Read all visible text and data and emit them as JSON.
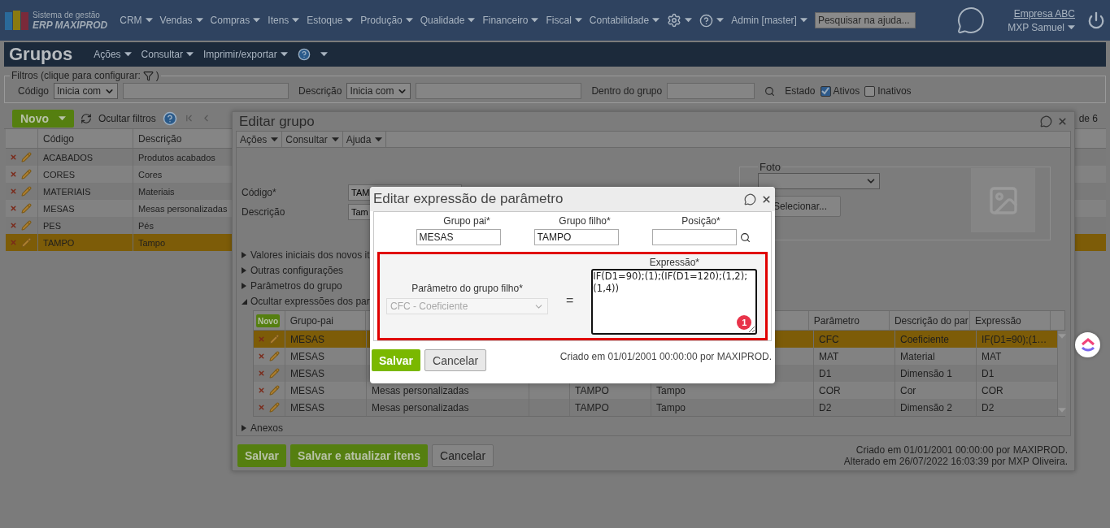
{
  "top_nav": {
    "logo_line_1": "Sistema de gestão",
    "logo_line_2": "ERP MAXIPROD",
    "menus": [
      "CRM",
      "Vendas",
      "Compras",
      "Itens",
      "Estoque",
      "Produção",
      "Qualidade",
      "Financeiro",
      "Fiscal",
      "Contabilidade"
    ],
    "user_menu": "Admin [master]",
    "help_search": {
      "placeholder": "Pesquisar na ajuda..."
    },
    "company_link": "Empresa ABC",
    "user_name": "MXP Samuel"
  },
  "page_header": {
    "title": "Grupos",
    "menus": [
      "Ações",
      "Consultar",
      "Imprimir/exportar"
    ]
  },
  "filters": {
    "legend_start": "Filtros (clique para configurar:",
    "legend_end": ")",
    "fields": [
      {
        "label": "Código",
        "operator": "Inicia com"
      },
      {
        "label": "Descrição",
        "operator": "Inicia com"
      }
    ],
    "group_label": "Dentro do grupo",
    "state_label": "Estado",
    "states": [
      {
        "label": "Ativos",
        "checked": true
      },
      {
        "label": "Inativos",
        "checked": false
      }
    ]
  },
  "toolbar": {
    "new_button": "Novo",
    "hide_filters": "Ocultar filtros",
    "pagination_end": "de 6"
  },
  "groups_table": {
    "columns": [
      "Código",
      "Descrição"
    ],
    "rows": [
      {
        "code": "ACABADOS",
        "description": "Produtos acabados",
        "selected": false
      },
      {
        "code": "CORES",
        "description": "Cores",
        "selected": false
      },
      {
        "code": "MATERIAIS",
        "description": "Materiais",
        "selected": false
      },
      {
        "code": "MESAS",
        "description": "Mesas personalizadas",
        "selected": false
      },
      {
        "code": "PES",
        "description": "Pés",
        "selected": false
      },
      {
        "code": "TAMPO",
        "description": "Tampo",
        "selected": true
      }
    ]
  },
  "edit_group_dialog": {
    "title": "Editar grupo",
    "menus": [
      "Ações",
      "Consultar",
      "Ajuda"
    ],
    "fields": [
      {
        "label": "Código*",
        "value": "TAM"
      },
      {
        "label": "Descrição",
        "value": "Tam"
      }
    ],
    "photo": {
      "legend": "Foto",
      "select_button": "Selecionar..."
    },
    "sections": [
      {
        "label": "Valores iniciais dos novos it",
        "expanded": false
      },
      {
        "label": "Outras configurações",
        "expanded": false
      },
      {
        "label": "Parâmetros do grupo",
        "expanded": false
      },
      {
        "label": "Ocultar expressões dos par",
        "expanded": true
      }
    ],
    "expressions_table": {
      "new_button": "Novo",
      "headers": {
        "parent": "Grupo-pai",
        "parameter": "Parâmetro",
        "parameter_description": "Descrição do par",
        "expression": "Expressão"
      },
      "rows": [
        {
          "parent": "MESAS",
          "parameter": "CFC",
          "parameter_description": "Coeficiente",
          "expression": "IF(D1=90);(1…",
          "selected": true
        },
        {
          "parent": "MESAS",
          "parameter": "MAT",
          "parameter_description": "Material",
          "expression": "MAT",
          "selected": false
        },
        {
          "parent": "MESAS",
          "parameter": "D1",
          "parameter_description": "Dimensão 1",
          "expression": "D1",
          "selected": false
        },
        {
          "parent": "MESAS",
          "column_3": "Mesas personalizadas",
          "column_5": "TAMPO",
          "column_6": "Tampo",
          "parameter": "COR",
          "parameter_description": "Cor",
          "expression": "COR",
          "selected": false
        },
        {
          "parent": "MESAS",
          "column_3": "Mesas personalizadas",
          "column_5": "TAMPO",
          "column_6": "Tampo",
          "parameter": "D2",
          "parameter_description": "Dimensão 2",
          "expression": "D2",
          "selected": false
        }
      ]
    },
    "attachments": {
      "label": "Anexos",
      "expanded": false
    },
    "buttons": {
      "save": "Salvar",
      "save_update": "Salvar e atualizar itens",
      "cancel": "Cancelar"
    },
    "footer": [
      "Criado em 01/01/2001 00:00:00 por MAXIPROD.",
      "Alterado em 26/07/2022 16:03:39 por MXP Oliveira."
    ]
  },
  "parameter_dialog": {
    "title": "Editar expressão de parâmetro",
    "fields": [
      {
        "label": "Grupo pai*",
        "value": "MESAS"
      },
      {
        "label": "Grupo filho*",
        "value": "TAMPO"
      },
      {
        "label": "Posição*"
      }
    ],
    "parameter": {
      "label": "Parâmetro do grupo filho*",
      "value": "CFC - Coeficiente",
      "disabled": true
    },
    "equals": "=",
    "expression": {
      "label": "Expressão*",
      "value": "IF(D1=90);(1);(IF(D1=120);(1,2);(1,4))"
    },
    "annotation_badge": "1",
    "buttons": {
      "save": "Salvar",
      "cancel": "Cancelar"
    },
    "footer": "Criado em 01/01/2001 00:00:00 por MAXIPROD."
  }
}
